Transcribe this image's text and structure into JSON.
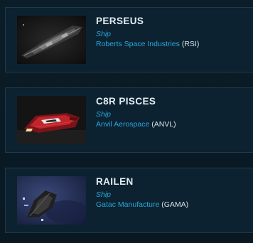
{
  "items": [
    {
      "name": "PERSEUS",
      "type": "Ship",
      "manufacturer": "Roberts Space Industries",
      "code_open": " (",
      "code": "RSI",
      "code_close": ")",
      "image": "perseus-ship-image"
    },
    {
      "name": "C8R PISCES",
      "type": "Ship",
      "manufacturer": "Anvil Aerospace",
      "code_open": " (",
      "code": "ANVL",
      "code_close": ")",
      "image": "c8r-pisces-ship-image"
    },
    {
      "name": "RAILEN",
      "type": "Ship",
      "manufacturer": "Gatac Manufacture",
      "code_open": " (",
      "code": "GAMA",
      "code_close": ")",
      "image": "railen-ship-image"
    }
  ],
  "colors": {
    "background": "#0b1d28",
    "card": "#0c2230",
    "border": "#1e3a4a",
    "accent": "#2aa6dc",
    "title": "#e4eef2"
  }
}
